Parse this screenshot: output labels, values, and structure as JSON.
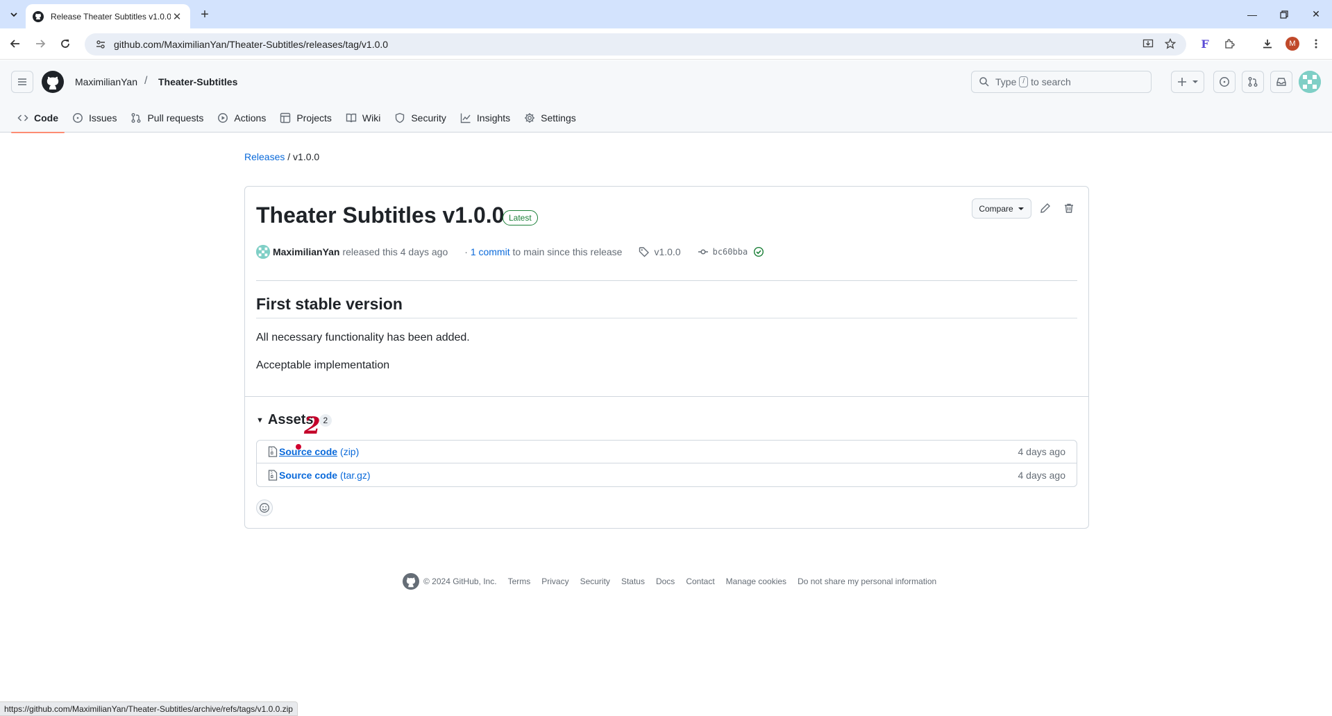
{
  "browser": {
    "tab_title": "Release Theater Subtitles v1.0.0",
    "url": "github.com/MaximilianYan/Theater-Subtitles/releases/tag/v1.0.0",
    "profile_initial": "M",
    "extension_letter": "F",
    "status_url": "https://github.com/MaximilianYan/Theater-Subtitles/archive/refs/tags/v1.0.0.zip"
  },
  "header": {
    "owner": "MaximilianYan",
    "separator": "/",
    "repo": "Theater-Subtitles",
    "search_prefix": "Type",
    "search_key": "/",
    "search_suffix": "to search"
  },
  "repo_nav": [
    {
      "label": "Code",
      "icon": "code-icon",
      "active": true
    },
    {
      "label": "Issues",
      "icon": "issue-icon"
    },
    {
      "label": "Pull requests",
      "icon": "pull-request-icon"
    },
    {
      "label": "Actions",
      "icon": "play-icon"
    },
    {
      "label": "Projects",
      "icon": "table-icon"
    },
    {
      "label": "Wiki",
      "icon": "book-icon"
    },
    {
      "label": "Security",
      "icon": "shield-icon"
    },
    {
      "label": "Insights",
      "icon": "graph-icon"
    },
    {
      "label": "Settings",
      "icon": "gear-icon"
    }
  ],
  "breadcrumb": {
    "releases": "Releases",
    "sep": "/",
    "current": "v1.0.0"
  },
  "release": {
    "title": "Theater Subtitles v1.0.0",
    "badge": "Latest",
    "compare_label": "Compare",
    "author": "MaximilianYan",
    "released_text": "released this 4 days ago",
    "commits_link": "1 commit",
    "commits_rest": "to main since this release",
    "tag": "v1.0.0",
    "sha": "bc60bba",
    "heading": "First stable version",
    "para1": "All necessary functionality has been added.",
    "para2": "Acceptable implementation"
  },
  "assets": {
    "label": "Assets",
    "count": "2",
    "items": [
      {
        "name": "Source code",
        "ext": "(zip)",
        "when": "4 days ago"
      },
      {
        "name": "Source code",
        "ext": "(tar.gz)",
        "when": "4 days ago"
      }
    ]
  },
  "annotation": {
    "marker": "2",
    "color": "#c4002a"
  },
  "footer": {
    "copyright": "© 2024 GitHub, Inc.",
    "links": [
      "Terms",
      "Privacy",
      "Security",
      "Status",
      "Docs",
      "Contact",
      "Manage cookies",
      "Do not share my personal information"
    ]
  },
  "colors": {
    "accent": "#0969da",
    "latest_green": "#1a7f37",
    "tab_underline": "#fd8c73",
    "check_green": "#1a7f37"
  }
}
